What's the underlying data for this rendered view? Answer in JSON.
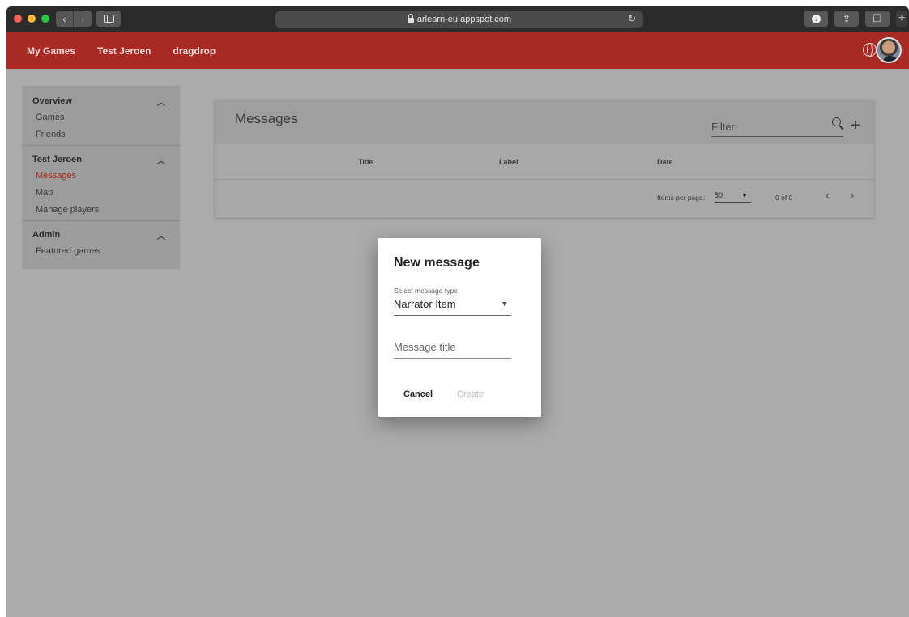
{
  "browser": {
    "url": "arlearn-eu.appspot.com"
  },
  "appbar": {
    "links": [
      "My Games",
      "Test Jeroen",
      "dragdrop"
    ]
  },
  "sidebar": {
    "sections": [
      {
        "title": "Overview",
        "items": [
          "Games",
          "Friends"
        ]
      },
      {
        "title": "Test Jeroen",
        "items": [
          "Messages",
          "Map",
          "Manage players"
        ],
        "active": "Messages"
      },
      {
        "title": "Admin",
        "items": [
          "Featured games"
        ]
      }
    ]
  },
  "messages_card": {
    "title": "Messages",
    "filter_placeholder": "Filter",
    "columns": [
      "Title",
      "Label",
      "Date"
    ],
    "items_per_page_label": "Items per page:",
    "items_per_page_value": "50",
    "range": "0 of 0"
  },
  "dialog": {
    "title": "New message",
    "type_label": "Select message type",
    "type_value": "Narrator Item",
    "title_placeholder": "Message title",
    "cancel_label": "Cancel",
    "create_label": "Create"
  },
  "colors": {
    "accent": "#a82a22",
    "active_link": "#a52a22"
  }
}
